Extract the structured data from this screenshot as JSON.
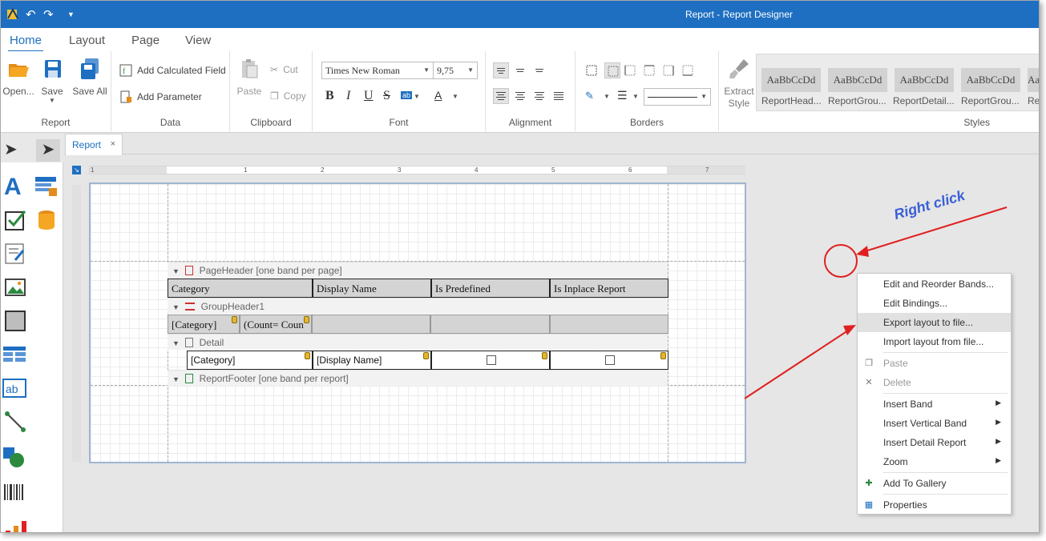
{
  "titlebar": {
    "title": "Report - Report Designer",
    "undo_icon": "undo-icon",
    "redo_icon": "redo-icon",
    "customize_icon": "chevron-down-icon"
  },
  "menu_tabs": [
    {
      "label": "Home"
    },
    {
      "label": "Layout"
    },
    {
      "label": "Page"
    },
    {
      "label": "View"
    }
  ],
  "ribbon": {
    "report": {
      "group": "Report",
      "open": "Open...",
      "save": "Save",
      "save_all": "Save All"
    },
    "data": {
      "group": "Data",
      "add_calc": "Add Calculated Field",
      "add_param": "Add Parameter"
    },
    "clipboard": {
      "group": "Clipboard",
      "paste": "Paste",
      "cut": "Cut",
      "copy": "Copy"
    },
    "font": {
      "group": "Font",
      "family": "Times New Roman",
      "size": "9,75",
      "bold": "B",
      "italic": "I",
      "underline": "U",
      "strike": "S",
      "ab": "ab",
      "color": "A"
    },
    "alignment": {
      "group": "Alignment"
    },
    "borders": {
      "group": "Borders"
    },
    "styles": {
      "group": "Styles",
      "extract": "Extract Style",
      "sample": "AaBbCcDd",
      "items": [
        "ReportHead...",
        "ReportGrou...",
        "ReportDetail...",
        "ReportGrou...",
        "Re"
      ]
    }
  },
  "doc_tab": {
    "label": "Report",
    "close": "×"
  },
  "ruler": {
    "nums": [
      "1",
      "1",
      "2",
      "3",
      "4",
      "5",
      "6",
      "7"
    ]
  },
  "bands": {
    "page_header": "PageHeader [one band per page]",
    "group_header": "GroupHeader1",
    "detail": "Detail",
    "report_footer": "ReportFooter [one band per report]"
  },
  "table": {
    "headers": [
      "Category",
      "Display Name",
      "Is Predefined",
      "Is Inplace Report"
    ],
    "group": [
      "[Category]",
      "(Count= Coun"
    ],
    "detail": [
      "[Category]",
      "[Display Name]"
    ]
  },
  "context_menu": {
    "items": [
      {
        "label": "Edit and Reorder Bands..."
      },
      {
        "label": "Edit Bindings..."
      },
      {
        "label": "Export layout to file..."
      },
      {
        "label": "Import layout from file..."
      },
      {
        "label": "Paste"
      },
      {
        "label": "Delete"
      },
      {
        "label": "Insert Band"
      },
      {
        "label": "Insert Vertical Band"
      },
      {
        "label": "Insert Detail Report"
      },
      {
        "label": "Zoom"
      },
      {
        "label": "Add To Gallery"
      },
      {
        "label": "Properties"
      }
    ]
  },
  "annotation": {
    "text": "Right click",
    "color": "#e02020",
    "text_color": "#3a5fd6"
  },
  "colors": {
    "accent": "#1e6fc1"
  }
}
